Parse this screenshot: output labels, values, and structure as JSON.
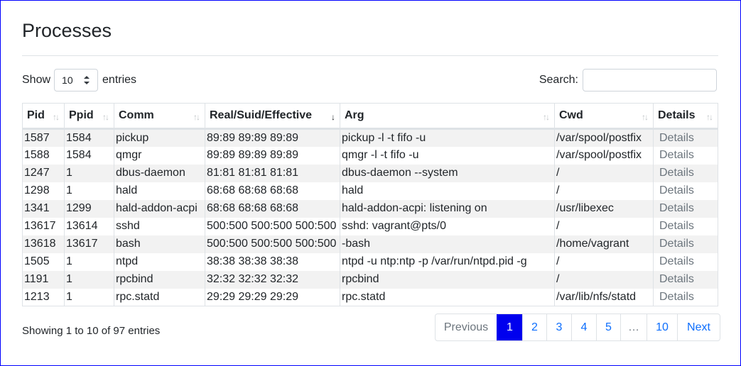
{
  "page": {
    "title": "Processes"
  },
  "length": {
    "label_before": "Show",
    "value": "10",
    "label_after": "entries"
  },
  "search": {
    "label": "Search:",
    "value": ""
  },
  "table": {
    "columns": [
      "Pid",
      "Ppid",
      "Comm",
      "Real/Suid/Effective",
      "Arg",
      "Cwd",
      "Details"
    ],
    "sort_column": "Real/Suid/Effective",
    "rows": [
      [
        "1587",
        "1584",
        "pickup",
        "89:89 89:89 89:89",
        "pickup -l -t fifo -u",
        "/var/spool/postfix",
        "Details"
      ],
      [
        "1588",
        "1584",
        "qmgr",
        "89:89 89:89 89:89",
        "qmgr -l -t fifo -u",
        "/var/spool/postfix",
        "Details"
      ],
      [
        "1247",
        "1",
        "dbus-daemon",
        "81:81 81:81 81:81",
        "dbus-daemon --system",
        "/",
        "Details"
      ],
      [
        "1298",
        "1",
        "hald",
        "68:68 68:68 68:68",
        "hald",
        "/",
        "Details"
      ],
      [
        "1341",
        "1299",
        "hald-addon-acpi",
        "68:68 68:68 68:68",
        "hald-addon-acpi: listening on",
        "/usr/libexec",
        "Details"
      ],
      [
        "13617",
        "13614",
        "sshd",
        "500:500 500:500 500:500",
        "sshd: vagrant@pts/0",
        "/",
        "Details"
      ],
      [
        "13618",
        "13617",
        "bash",
        "500:500 500:500 500:500",
        "-bash",
        "/home/vagrant",
        "Details"
      ],
      [
        "1505",
        "1",
        "ntpd",
        "38:38 38:38 38:38",
        "ntpd -u ntp:ntp -p /var/run/ntpd.pid -g",
        "/",
        "Details"
      ],
      [
        "1191",
        "1",
        "rpcbind",
        "32:32 32:32 32:32",
        "rpcbind",
        "/",
        "Details"
      ],
      [
        "1213",
        "1",
        "rpc.statd",
        "29:29 29:29 29:29",
        "rpc.statd",
        "/var/lib/nfs/statd",
        "Details"
      ]
    ]
  },
  "info": "Showing 1 to 10 of 97 entries",
  "pagination": {
    "items": [
      {
        "label": "Previous",
        "state": "disabled"
      },
      {
        "label": "1",
        "state": "active"
      },
      {
        "label": "2",
        "state": "normal"
      },
      {
        "label": "3",
        "state": "normal"
      },
      {
        "label": "4",
        "state": "normal"
      },
      {
        "label": "5",
        "state": "normal"
      },
      {
        "label": "…",
        "state": "ellipsis"
      },
      {
        "label": "10",
        "state": "normal"
      },
      {
        "label": "Next",
        "state": "normal"
      }
    ]
  },
  "colors": {
    "active_page": "#0000ee",
    "link": "#0d6efd",
    "frame_border": "#0000ff",
    "stripe": "#f2f2f2"
  },
  "icons": {
    "sort": "sort-arrows-icon",
    "sort_active": "sort-desc-icon",
    "select": "select-arrows-icon"
  }
}
